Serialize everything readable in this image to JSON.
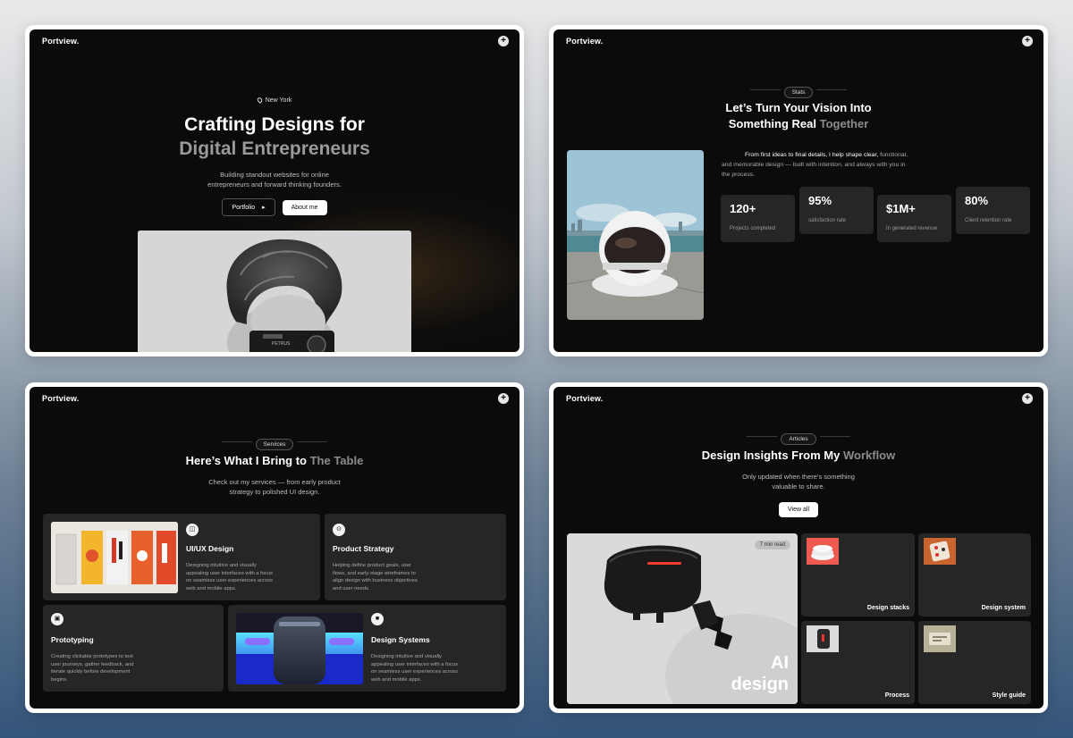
{
  "brand": "Portview.",
  "panel1": {
    "location": "New York",
    "title_line1": "Crafting Designs for",
    "title_line2": "Digital Entrepreneurs",
    "subtitle_line1": "Building standout websites for online",
    "subtitle_line2": "entrepreneurs and forward thinking founders.",
    "btn_portfolio": "Portfolio",
    "btn_about": "About me",
    "camera_brand": "PETRUS"
  },
  "panel2": {
    "pill": "Stats",
    "title_line1": "Let’s Turn Your Vision Into",
    "title_line2a": "Something Real",
    "title_line2b": "Together",
    "desc_line1_bold": "From first ideas to final details, I help shape clear,",
    "desc_line1_dim": "functional,",
    "desc_line2": "and memorable design — built with intention, and always with you in",
    "desc_line3": "the process.",
    "stats": [
      {
        "value": "120+",
        "label": "Projects completed"
      },
      {
        "value": "95%",
        "label": "satisfaction rate"
      },
      {
        "value": "$1M+",
        "label": "In generated revenue"
      },
      {
        "value": "80%",
        "label": "Client retention rate"
      }
    ]
  },
  "panel3": {
    "pill": "Services",
    "title_a": "Here’s What I Bring to",
    "title_b": "The Table",
    "subtitle_line1": "Check out my services — from early product",
    "subtitle_line2": "strategy to polished UI design.",
    "services": [
      {
        "title": "UI/UX Design",
        "desc1": "Designing intuitive and visually",
        "desc2": "appealing user interfaces with a focus",
        "desc3": "on seamless user experiences across",
        "desc4": "web and mobile apps."
      },
      {
        "title": "Product Strategy",
        "desc1": "Helping define product goals, user",
        "desc2": "flows, and early-stage wireframes to",
        "desc3": "align design with business objectives",
        "desc4": "and user needs."
      },
      {
        "title": "Prototyping",
        "desc1": "Creating clickable prototypes to test",
        "desc2": "user journeys, gather feedback, and",
        "desc3": "iterate quickly before development",
        "desc4": "begins."
      },
      {
        "title": "Design Systems",
        "desc1": "Designing intuitive and visually",
        "desc2": "appealing user interfaces with a focus",
        "desc3": "on seamless user experiences across",
        "desc4": "web and mobile apps."
      }
    ]
  },
  "panel4": {
    "pill": "Articles",
    "title_a": "Design Insights From My",
    "title_b": "Workflow",
    "subtitle_line1": "Only updated when there’s something",
    "subtitle_line2": "valuable to share.",
    "btn_view_all": "View all",
    "feature_badge": "7 min read",
    "feature_title_line1": "AI",
    "feature_title_line2": "design",
    "articles": [
      {
        "title": "Design stacks"
      },
      {
        "title": "Design system"
      },
      {
        "title": "Process"
      },
      {
        "title": "Style guide"
      }
    ]
  }
}
